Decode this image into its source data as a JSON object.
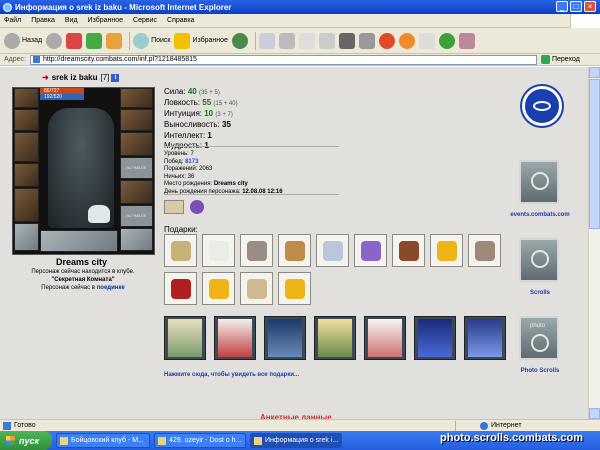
{
  "window": {
    "title": "Информация о srek iz baku - Microsoft Internet Explorer",
    "buttons": {
      "min": "_",
      "max": "□",
      "close": "×"
    }
  },
  "menu": [
    "Файл",
    "Правка",
    "Вид",
    "Избранное",
    "Сервис",
    "Справка"
  ],
  "toolbar": {
    "back": "Назад",
    "search": "Поиск",
    "favorites": "Избранное"
  },
  "address": {
    "label": "Адрес:",
    "url": "http://dreamscity.combats.com/inf.pl?1218485815",
    "go": "Переход"
  },
  "character": {
    "name": "srek iz baku",
    "level": "[7]",
    "hp": "86/727",
    "mp": "192/520",
    "noimage": "NO IMAGE",
    "city": "Dreams city",
    "location_line1": "Персонаж сейчас находится в клубе.",
    "location_club": "\"Секретная Комната\"",
    "location_line2": "Персонаж сейчас в",
    "location_link": "поединке"
  },
  "stats": [
    {
      "label": "Сила:",
      "value": "40",
      "bonus": "(35 + 5)"
    },
    {
      "label": "Ловкость:",
      "value": "55",
      "bonus": "(15 + 40)"
    },
    {
      "label": "Интуиция:",
      "value": "10",
      "bonus": "(3 + 7)"
    },
    {
      "label": "Выносливость:",
      "value": "35",
      "bonus": ""
    },
    {
      "label": "Интеллект:",
      "value": "1",
      "bonus": ""
    },
    {
      "label": "Мудрость:",
      "value": "1",
      "bonus": ""
    }
  ],
  "info": {
    "level_label": "Уровень:",
    "level": "7",
    "wins_label": "Побед:",
    "wins": "8173",
    "losses_label": "Поражений:",
    "losses": "2063",
    "draws_label": "Ничьих:",
    "draws": "36",
    "born_label": "Место рождения:",
    "born": "Dreams city",
    "bday_label": "День рождения персонажа:",
    "bday": "12.08.08 12:16"
  },
  "gifts_label": "Подарки:",
  "more_gifts": "Нажмите сюда, чтобы увидеть все подарки...",
  "sidebar": {
    "link1": "events.combats.com",
    "link2": "Scrolls",
    "link3": "Photo Scrolls",
    "banner3_text": "photo"
  },
  "footer_heading": "Анкетные данные",
  "status": {
    "ready": "Готово",
    "zone": "Интернет"
  },
  "taskbar": {
    "start": "пуск",
    "tasks": [
      "Бойцовский клуб - M...",
      "429. uzeyir - Dost o h...",
      "Информация о srek i..."
    ]
  },
  "watermark": "photo.scrolls.combats.com",
  "colors": {
    "title_bar": "#0a3fc4",
    "page_bg": "#e2e0dd",
    "link": "#1b3ea8",
    "heading_red": "#c6322b"
  }
}
